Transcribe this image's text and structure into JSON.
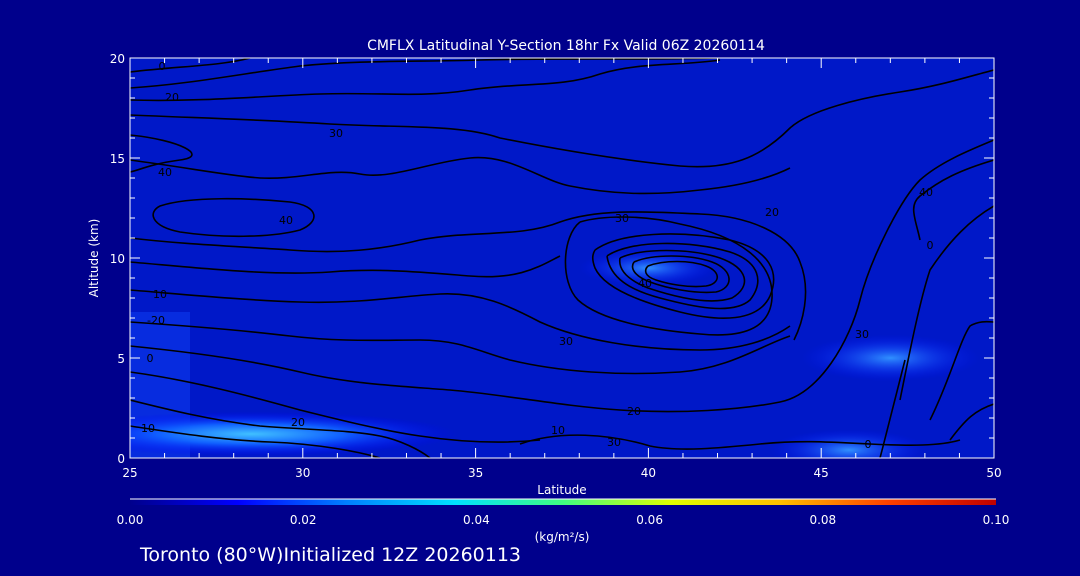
{
  "chart_data": {
    "type": "heatmap",
    "title": "CMFLX Latitudinal Y-Section 18hr  Fx Valid 06Z 20260114",
    "xlabel": "Latitude",
    "ylabel": "Altitude (km)",
    "xlim": [
      25,
      50
    ],
    "ylim": [
      0,
      20
    ],
    "x_ticks": [
      "25",
      "30",
      "35",
      "40",
      "45",
      "50"
    ],
    "y_ticks": [
      "0",
      "5",
      "10",
      "15",
      "20"
    ],
    "contour_labels": [
      "0",
      "20",
      "30",
      "40",
      "40",
      "30",
      "20",
      "10",
      "-20",
      "0",
      "40",
      "30",
      "20",
      "10",
      "0",
      "0",
      "20",
      "10",
      "30",
      "40",
      "30"
    ],
    "colorbar": {
      "min": 0.0,
      "max": 0.1,
      "ticks": [
        "0.00",
        "0.02",
        "0.04",
        "0.06",
        "0.08",
        "0.10"
      ],
      "colors": [
        "#00008c",
        "#0000ff",
        "#0080ff",
        "#00e0ff",
        "#40ff80",
        "#e0ff00",
        "#ffc000",
        "#ff4000",
        "#c00000"
      ],
      "unit_label": "(kg/m²/s)"
    },
    "flux_maxima": [
      {
        "lat": 28.5,
        "alt": 1.2,
        "value": 0.018
      },
      {
        "lat": 40.0,
        "alt": 9.5,
        "value": 0.008
      },
      {
        "lat": 47.0,
        "alt": 5.0,
        "value": 0.012
      },
      {
        "lat": 45.8,
        "alt": 0.4,
        "value": 0.01
      }
    ]
  },
  "footer": {
    "text": "Toronto (80°W)Initialized 12Z 20260113"
  }
}
